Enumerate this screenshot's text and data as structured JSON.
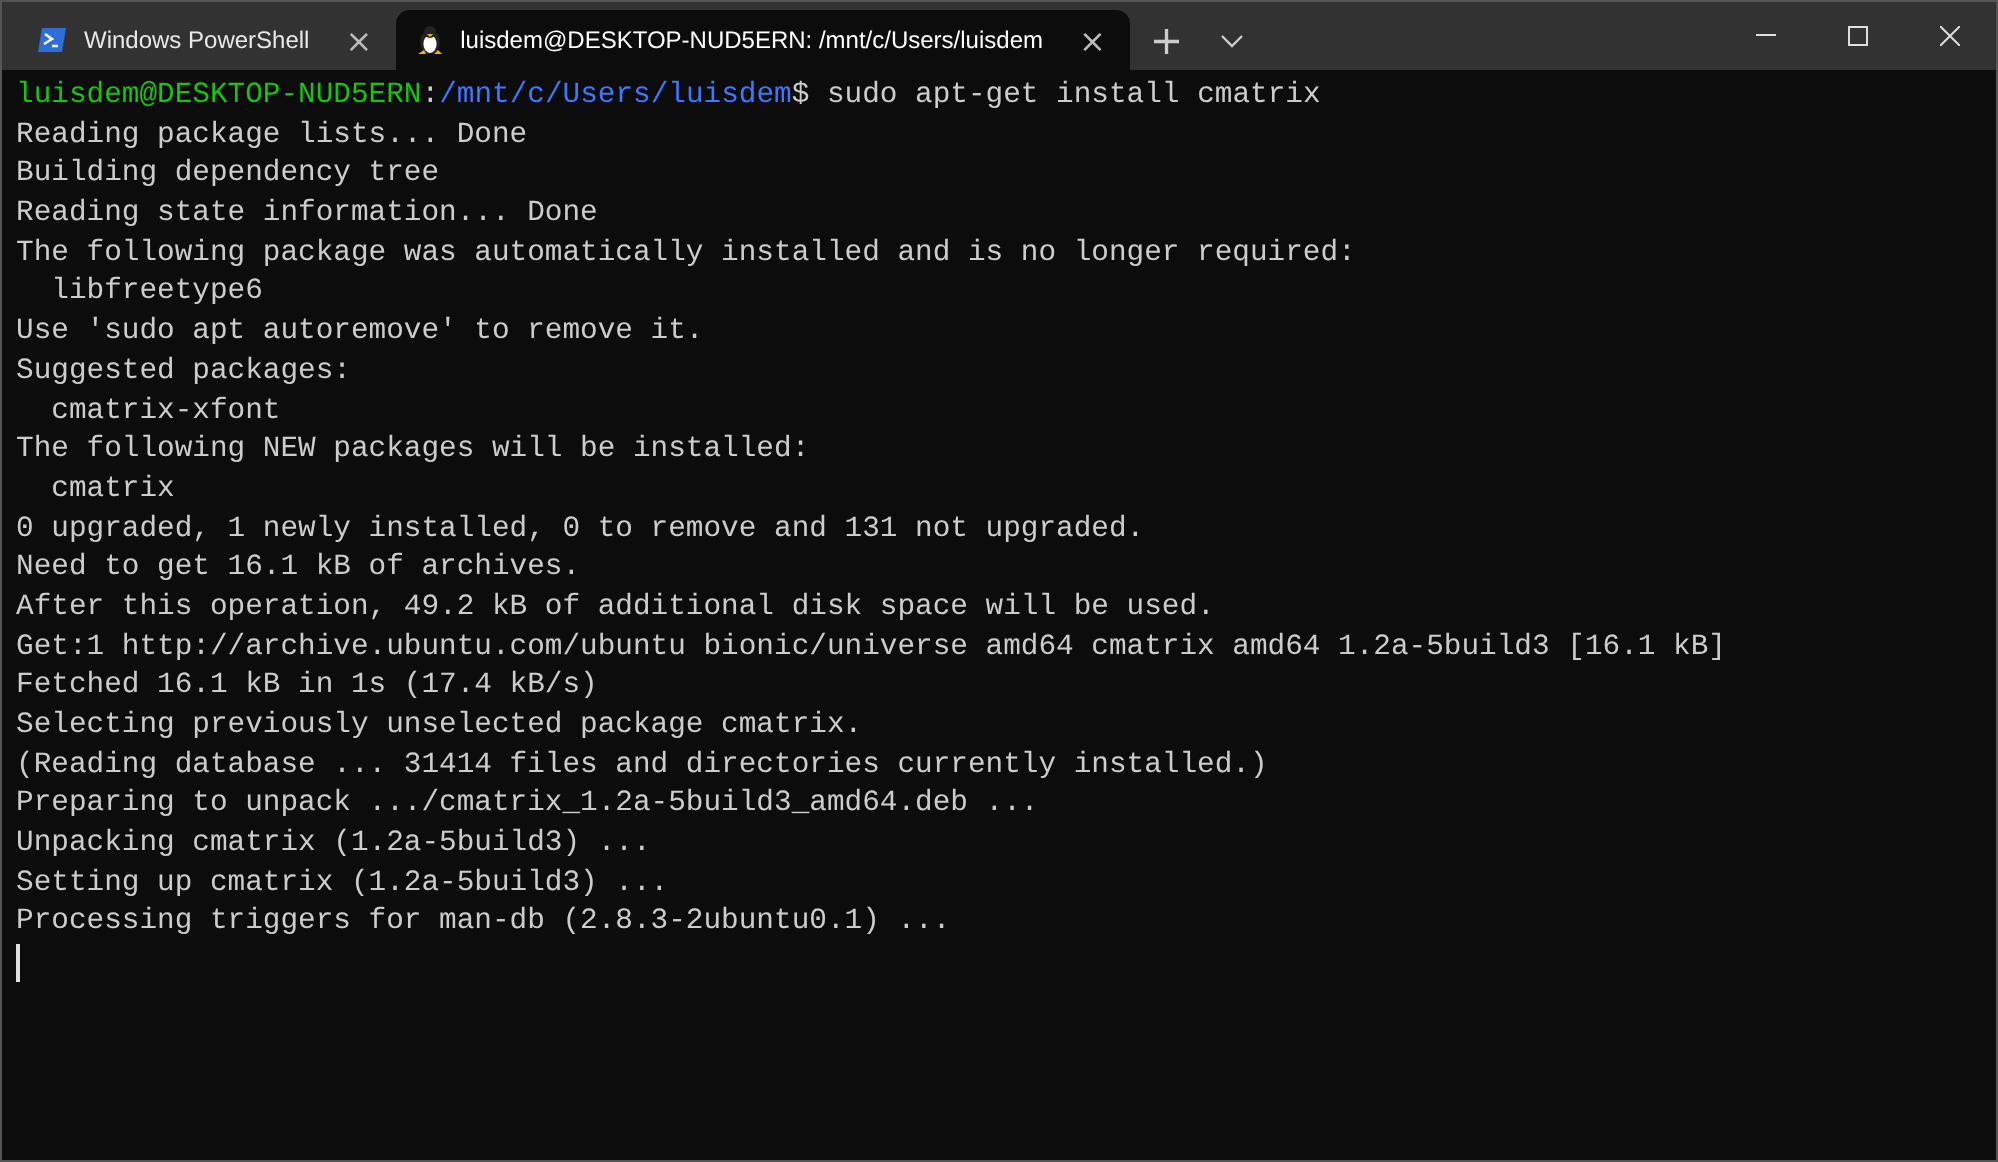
{
  "tabs": [
    {
      "label": "Windows PowerShell",
      "kind": "powershell",
      "selected": false,
      "close": "×"
    },
    {
      "label": "luisdem@DESKTOP-NUD5ERN: /mnt/c/Users/luisdem",
      "kind": "linux",
      "selected": true,
      "close": "×"
    }
  ],
  "new_tab": "+",
  "terminal": {
    "lines": [
      {
        "kind": "prompt",
        "user_host": "luisdem@DESKTOP-NUD5ERN",
        "separator": ":",
        "path": "/mnt/c/Users/luisdem",
        "command": "$ sudo apt-get install cmatrix"
      },
      {
        "kind": "output",
        "text": "Reading package lists... Done"
      },
      {
        "kind": "output",
        "text": "Building dependency tree"
      },
      {
        "kind": "output",
        "text": "Reading state information... Done"
      },
      {
        "kind": "output",
        "text": "The following package was automatically installed and is no longer required:"
      },
      {
        "kind": "output",
        "text": "  libfreetype6"
      },
      {
        "kind": "output",
        "text": "Use 'sudo apt autoremove' to remove it."
      },
      {
        "kind": "output",
        "text": "Suggested packages:"
      },
      {
        "kind": "output",
        "text": "  cmatrix-xfont"
      },
      {
        "kind": "output",
        "text": "The following NEW packages will be installed:"
      },
      {
        "kind": "output",
        "text": "  cmatrix"
      },
      {
        "kind": "output",
        "text": "0 upgraded, 1 newly installed, 0 to remove and 131 not upgraded."
      },
      {
        "kind": "output",
        "text": "Need to get 16.1 kB of archives."
      },
      {
        "kind": "output",
        "text": "After this operation, 49.2 kB of additional disk space will be used."
      },
      {
        "kind": "output",
        "text": "Get:1 http://archive.ubuntu.com/ubuntu bionic/universe amd64 cmatrix amd64 1.2a-5build3 [16.1 kB]"
      },
      {
        "kind": "output",
        "text": "Fetched 16.1 kB in 1s (17.4 kB/s)"
      },
      {
        "kind": "output",
        "text": "Selecting previously unselected package cmatrix."
      },
      {
        "kind": "output",
        "text": "(Reading database ... 31414 files and directories currently installed.)"
      },
      {
        "kind": "output",
        "text": "Preparing to unpack .../cmatrix_1.2a-5build3_amd64.deb ..."
      },
      {
        "kind": "output",
        "text": "Unpacking cmatrix (1.2a-5build3) ..."
      },
      {
        "kind": "output",
        "text": "Setting up cmatrix (1.2a-5build3) ..."
      },
      {
        "kind": "output",
        "text": "Processing triggers for man-db (2.8.3-2ubuntu0.1) ..."
      },
      {
        "kind": "cursor"
      }
    ]
  }
}
